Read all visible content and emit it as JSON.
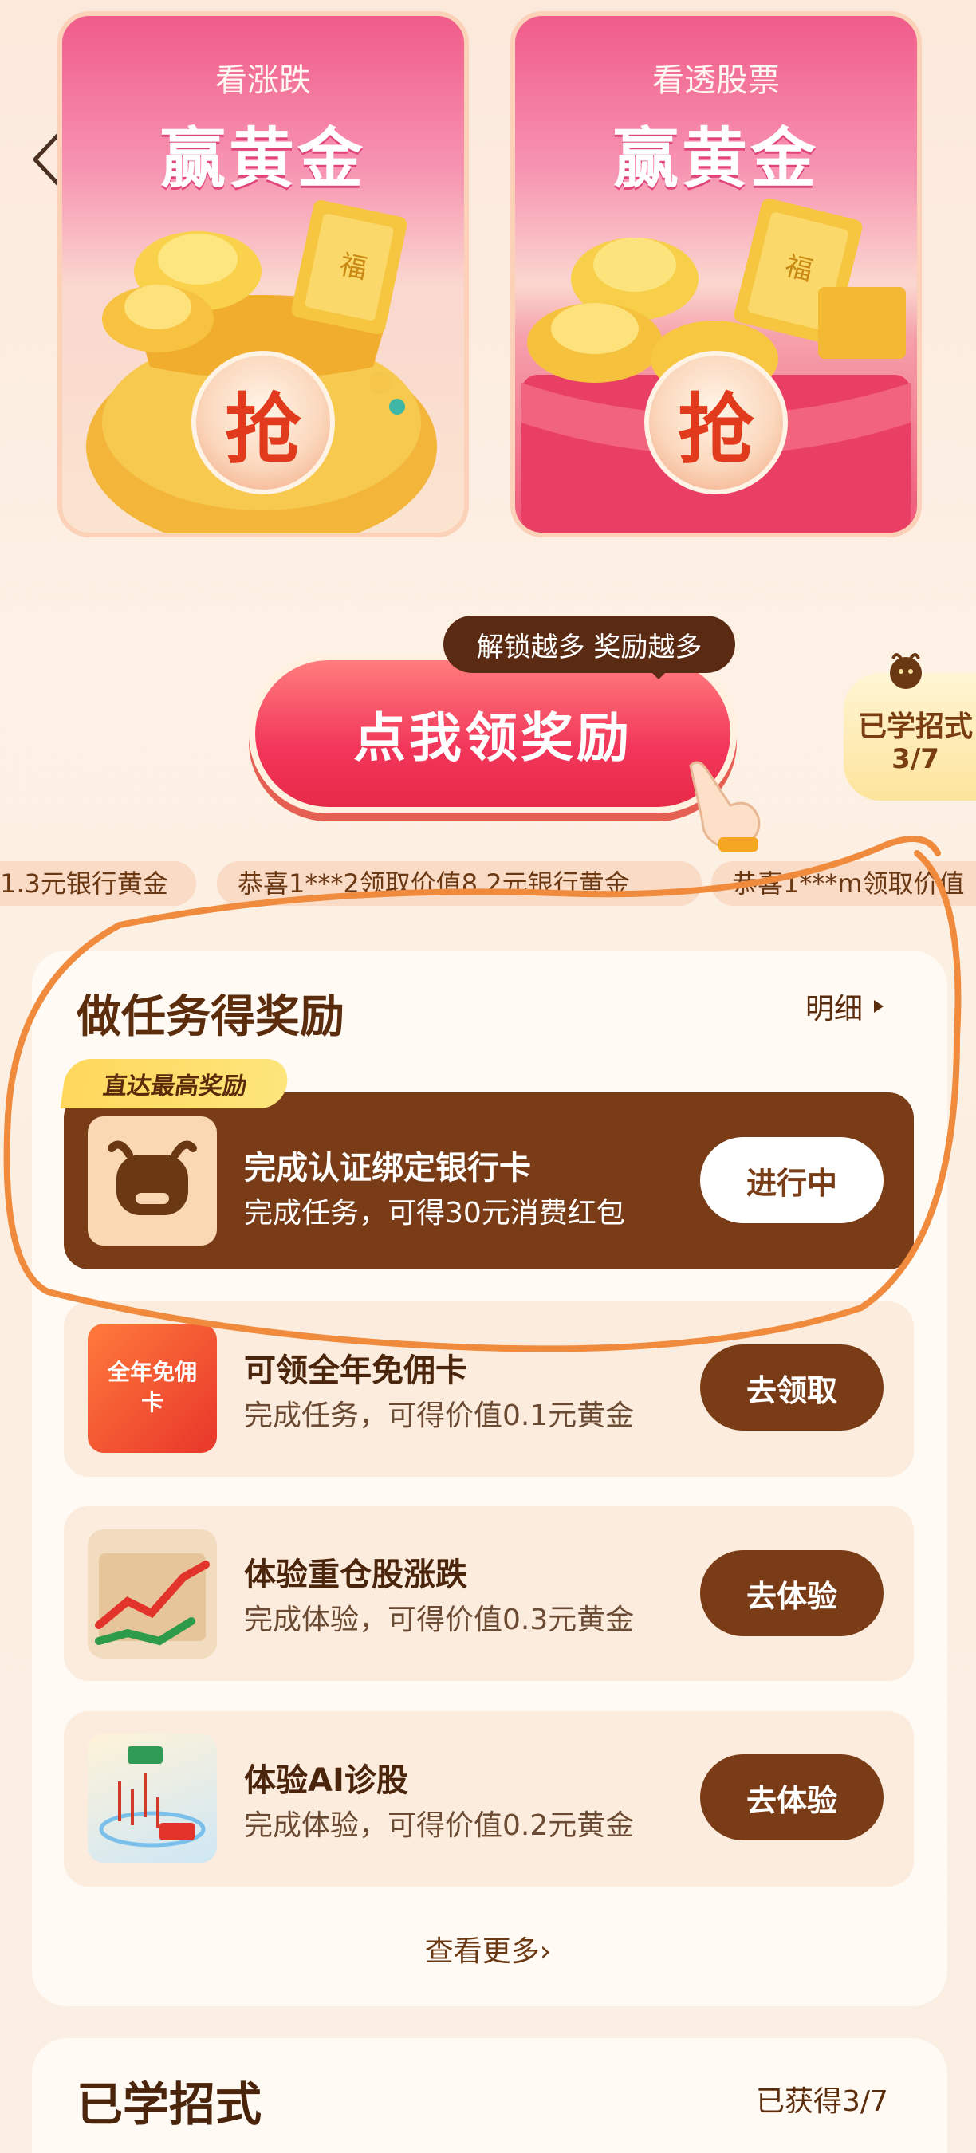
{
  "cards": [
    {
      "subtitle": "看涨跌",
      "title": "赢黄金",
      "grab_label": "抢"
    },
    {
      "subtitle": "看透股票",
      "title": "赢黄金",
      "grab_label": "抢"
    }
  ],
  "cta": {
    "label": "点我领奖励",
    "tip": "解锁越多 奖励越多"
  },
  "learned_badge": {
    "label": "已学招式",
    "progress": "3/7"
  },
  "marquee": [
    "1.3元银行黄金",
    "恭喜1***2领取价值8.2元银行黄金",
    "恭喜1***m领取价值"
  ],
  "tasks_section": {
    "title": "做任务得奖励",
    "detail_label": "明细",
    "featured_tag": "直达最高奖励",
    "tasks": [
      {
        "name": "完成认证绑定银行卡",
        "desc": "完成任务，可得30元消费红包",
        "action": "进行中",
        "thumb_text": ""
      },
      {
        "name": "可领全年免佣卡",
        "desc": "完成任务，可得价值0.1元黄金",
        "action": "去领取",
        "thumb_text": "全年免佣卡"
      },
      {
        "name": "体验重仓股涨跌",
        "desc": "完成体验，可得价值0.3元黄金",
        "action": "去体验",
        "thumb_text": ""
      },
      {
        "name": "体验AI诊股",
        "desc": "完成体验，可得价值0.2元黄金",
        "action": "去体验",
        "thumb_text": ""
      }
    ],
    "see_more": "查看更多"
  },
  "learned_section": {
    "title": "已学招式",
    "count": "已获得3/7"
  },
  "colors": {
    "brown": "#7a3c16",
    "pink": "#f05b8a",
    "gold": "#f5b92c",
    "cta_red": "#f2365a",
    "annotation": "#f08a3c"
  }
}
